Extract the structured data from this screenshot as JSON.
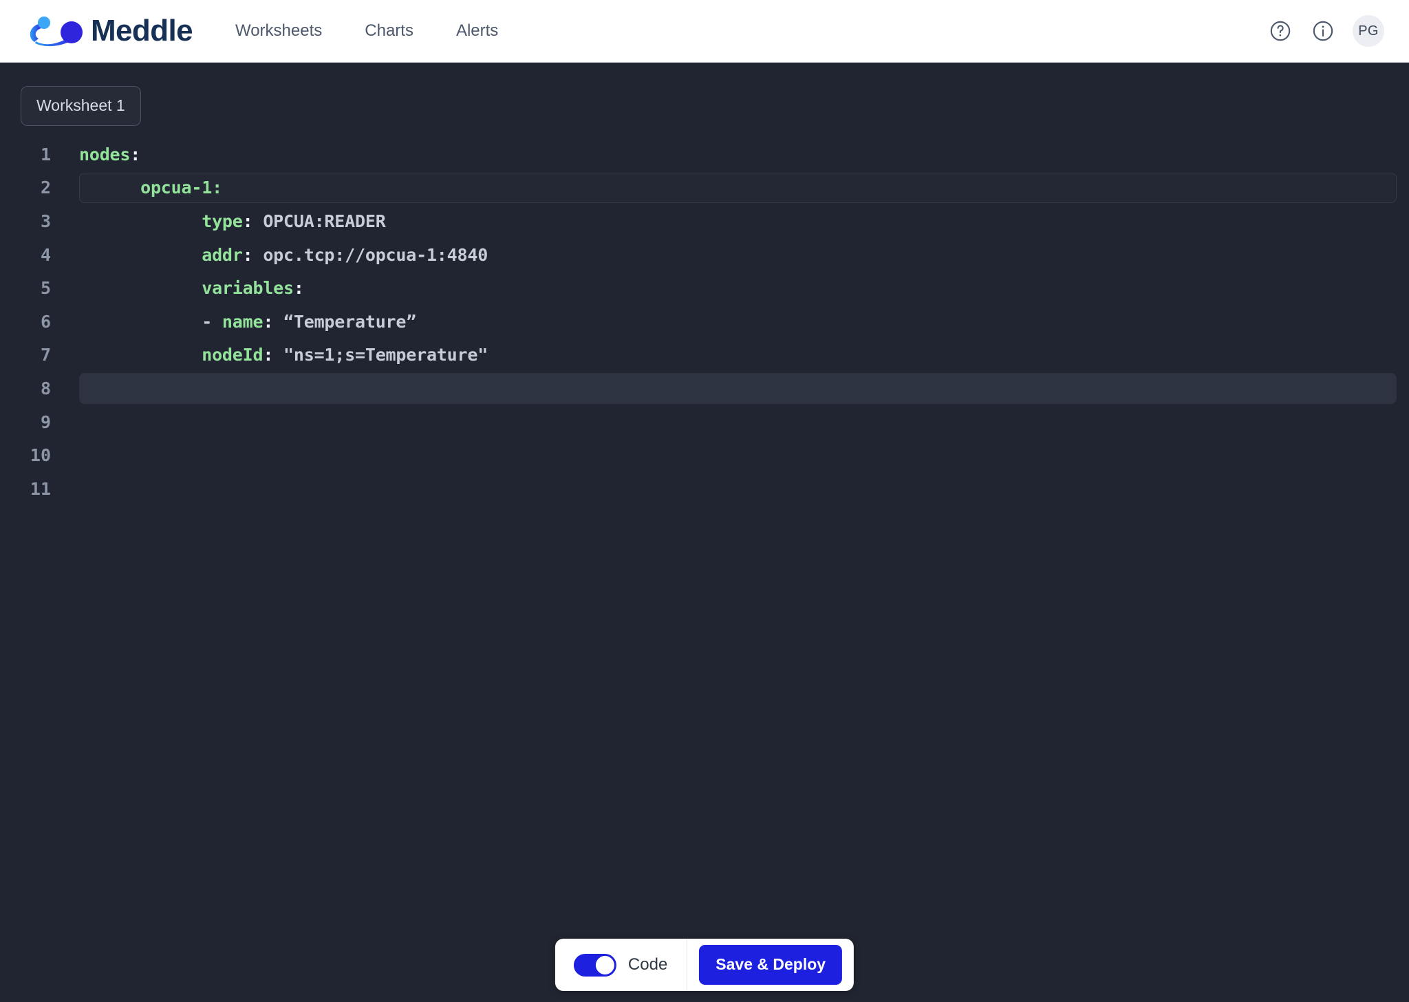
{
  "app": {
    "brand_name": "Meddle",
    "brand_color": "#173055",
    "accent_color": "#1d20df",
    "editor_bg": "#212531",
    "keyword_color": "#93e39b"
  },
  "header": {
    "logo_icon": "meddle-comet-logo",
    "nav": [
      {
        "label": "Worksheets",
        "name": "worksheets"
      },
      {
        "label": "Charts",
        "name": "charts"
      },
      {
        "label": "Alerts",
        "name": "alerts"
      }
    ],
    "help_icon": "question-circle-icon",
    "info_icon": "info-circle-icon",
    "avatar_initials": "PG"
  },
  "tabs": [
    {
      "label": "Worksheet 1",
      "active": true
    }
  ],
  "editor": {
    "language": "yaml",
    "active_line": 8,
    "outlined_line": 2,
    "lines": [
      {
        "n": "1",
        "segments": [
          {
            "t": "nodes",
            "c": "k"
          },
          {
            "t": ":",
            "c": "p"
          }
        ],
        "indent": 0
      },
      {
        "n": "2",
        "segments": [
          {
            "t": "opcua-1:",
            "c": "k"
          }
        ],
        "indent": 2
      },
      {
        "n": "3",
        "segments": [
          {
            "t": "type",
            "c": "k"
          },
          {
            "t": ": ",
            "c": "p"
          },
          {
            "t": "OPCUA:READER",
            "c": "v"
          }
        ],
        "indent": 4
      },
      {
        "n": "4",
        "segments": [
          {
            "t": "addr",
            "c": "k"
          },
          {
            "t": ": ",
            "c": "p"
          },
          {
            "t": "opc.tcp://opcua-1:4840",
            "c": "v"
          }
        ],
        "indent": 4
      },
      {
        "n": "5",
        "segments": [
          {
            "t": "variables",
            "c": "k"
          },
          {
            "t": ":",
            "c": "p"
          }
        ],
        "indent": 4
      },
      {
        "n": "6",
        "segments": [
          {
            "t": "- ",
            "c": "d"
          },
          {
            "t": "name",
            "c": "k"
          },
          {
            "t": ": ",
            "c": "p"
          },
          {
            "t": "“Temperature”",
            "c": "v"
          }
        ],
        "indent": 4
      },
      {
        "n": "7",
        "segments": [
          {
            "t": "nodeId",
            "c": "k"
          },
          {
            "t": ": ",
            "c": "p"
          },
          {
            "t": "\"ns=1;s=Temperature\"",
            "c": "v"
          }
        ],
        "indent": 4
      },
      {
        "n": "8",
        "segments": [],
        "indent": 4
      },
      {
        "n": "9",
        "segments": [],
        "indent": 0
      },
      {
        "n": "10",
        "segments": [],
        "indent": 0
      },
      {
        "n": "11",
        "segments": [],
        "indent": 0
      }
    ]
  },
  "bottom_bar": {
    "toggle_label": "Code",
    "toggle_on": true,
    "deploy_label": "Save & Deploy"
  }
}
